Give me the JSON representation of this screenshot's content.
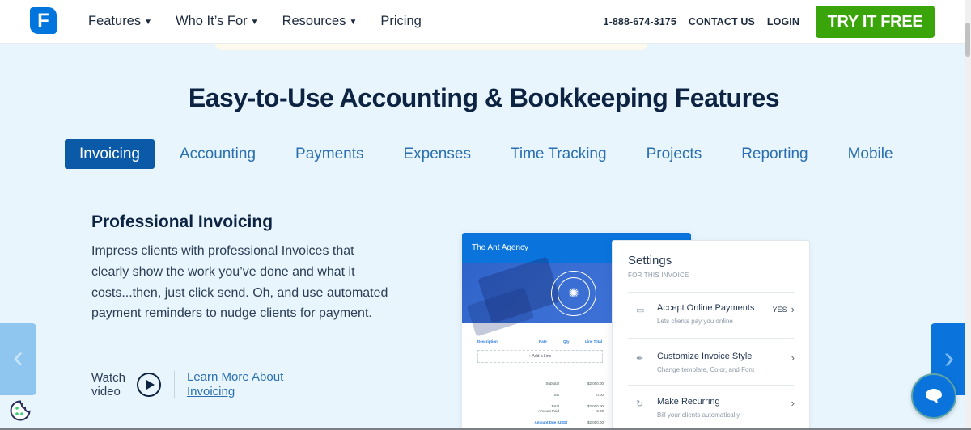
{
  "header": {
    "logo_letter": "F",
    "nav": [
      {
        "label": "Features",
        "has_dropdown": true
      },
      {
        "label": "Who It’s For",
        "has_dropdown": true
      },
      {
        "label": "Resources",
        "has_dropdown": true
      },
      {
        "label": "Pricing",
        "has_dropdown": false
      }
    ],
    "chevron": "⌄",
    "phone": "1-888-674-3175",
    "contact": "CONTACT US",
    "login": "LOGIN",
    "cta": "TRY IT FREE",
    "cta_color": "#3aa50a"
  },
  "main": {
    "title": "Easy-to-Use Accounting & Bookkeeping Features",
    "tabs": [
      {
        "label": "Invoicing",
        "active": true
      },
      {
        "label": "Accounting",
        "active": false
      },
      {
        "label": "Payments",
        "active": false
      },
      {
        "label": "Expenses",
        "active": false
      },
      {
        "label": "Time Tracking",
        "active": false
      },
      {
        "label": "Projects",
        "active": false
      },
      {
        "label": "Reporting",
        "active": false
      },
      {
        "label": "Mobile",
        "active": false
      }
    ],
    "feature": {
      "title": "Professional Invoicing",
      "description": "Impress clients with professional Invoices that clearly show the work you’ve done and what it costs...then, just click send. Oh, and use automated payment reminders to nudge clients for payment.",
      "watch_line1": "Watch",
      "watch_line2": "video",
      "learn_line1": "Learn More About",
      "learn_line2": "Invoicing"
    },
    "carousel": {
      "prev_icon": "‹",
      "next_icon": "›"
    }
  },
  "invoice_preview": {
    "company": "The Ant Agency",
    "columns": [
      "Description",
      "Rate",
      "Qty",
      "Line Total"
    ],
    "add_line": "+ Add a Line",
    "totals": [
      {
        "label": "Subtotal",
        "value": "$2,000.00"
      },
      {
        "label": "Tax",
        "value": "0.00"
      },
      {
        "label": "Total",
        "value": "$2,000.00"
      },
      {
        "label": "Amount Paid",
        "value": "0.00"
      },
      {
        "label": "Amount Due (USD)",
        "value": "$2,000.00"
      }
    ]
  },
  "settings_panel": {
    "title": "Settings",
    "subtitle": "FOR THIS INVOICE",
    "items": [
      {
        "title": "Accept Online Payments",
        "desc": "Lets clients pay you online",
        "value": "YES",
        "icon": "laptop-icon"
      },
      {
        "title": "Customize Invoice Style",
        "desc": "Change template, Color, and Font",
        "value": "",
        "icon": "paint-brush-icon"
      },
      {
        "title": "Make Recurring",
        "desc": "Bill your clients automatically",
        "value": "",
        "icon": "recurring-icon"
      }
    ]
  }
}
